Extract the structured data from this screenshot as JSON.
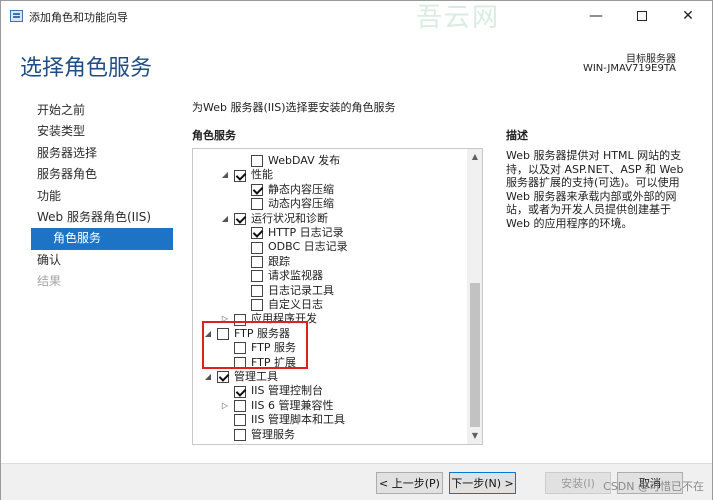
{
  "window": {
    "title": "添加角色和功能向导",
    "watermark_top": "吾云网",
    "controls": {
      "minimize": "—",
      "close": "✕"
    }
  },
  "header": {
    "page_title": "选择角色服务",
    "target_label": "目标服务器",
    "target_value": "WIN-JMAV719E9TA"
  },
  "nav": {
    "items": [
      {
        "label": "开始之前"
      },
      {
        "label": "安装类型"
      },
      {
        "label": "服务器选择"
      },
      {
        "label": "服务器角色"
      },
      {
        "label": "功能"
      },
      {
        "label": "Web 服务器角色(IIS)"
      },
      {
        "label": "角色服务"
      },
      {
        "label": "确认"
      },
      {
        "label": "结果"
      }
    ]
  },
  "main": {
    "description_line": "为Web 服务器(IIS)选择要安装的角色服务",
    "roles_heading": "角色服务",
    "description_heading": "描述",
    "description_text": "Web 服务器提供对 HTML 网站的支持，以及对 ASP.NET、ASP 和 Web 服务器扩展的支持(可选)。可以使用 Web 服务器来承载内部或外部的网站，或者为开发人员提供创建基于 Web 的应用程序的环境。"
  },
  "tree": {
    "items": [
      {
        "label": "WebDAV 发布",
        "state": "unchecked",
        "level": 2,
        "expander": "none"
      },
      {
        "label": "性能",
        "state": "checked",
        "level": 1,
        "expander": "expanded"
      },
      {
        "label": "静态内容压缩",
        "state": "checked",
        "level": 2,
        "expander": "none"
      },
      {
        "label": "动态内容压缩",
        "state": "unchecked",
        "level": 2,
        "expander": "none"
      },
      {
        "label": "运行状况和诊断",
        "state": "checked",
        "level": 1,
        "expander": "expanded"
      },
      {
        "label": "HTTP 日志记录",
        "state": "checked",
        "level": 2,
        "expander": "none"
      },
      {
        "label": "ODBC 日志记录",
        "state": "unchecked",
        "level": 2,
        "expander": "none"
      },
      {
        "label": "跟踪",
        "state": "unchecked",
        "level": 2,
        "expander": "none"
      },
      {
        "label": "请求监视器",
        "state": "unchecked",
        "level": 2,
        "expander": "none"
      },
      {
        "label": "日志记录工具",
        "state": "unchecked",
        "level": 2,
        "expander": "none"
      },
      {
        "label": "自定义日志",
        "state": "unchecked",
        "level": 2,
        "expander": "none"
      },
      {
        "label": "应用程序开发",
        "state": "unchecked",
        "level": 1,
        "expander": "collapsed"
      },
      {
        "label": "FTP 服务器",
        "state": "unchecked",
        "level": 0,
        "expander": "expanded"
      },
      {
        "label": "FTP 服务",
        "state": "unchecked",
        "level": 1,
        "expander": "none"
      },
      {
        "label": "FTP 扩展",
        "state": "unchecked",
        "level": 1,
        "expander": "none"
      },
      {
        "label": "管理工具",
        "state": "checked",
        "level": 0,
        "expander": "expanded"
      },
      {
        "label": "IIS 管理控制台",
        "state": "checked",
        "level": 1,
        "expander": "none"
      },
      {
        "label": "IIS 6 管理兼容性",
        "state": "unchecked",
        "level": 1,
        "expander": "collapsed"
      },
      {
        "label": "IIS 管理脚本和工具",
        "state": "unchecked",
        "level": 1,
        "expander": "none"
      },
      {
        "label": "管理服务",
        "state": "unchecked",
        "level": 1,
        "expander": "none"
      }
    ],
    "highlight_color": "#e0201e"
  },
  "footer": {
    "prev_label": "< 上一步(P)",
    "next_label": "下一步(N) >",
    "install_label": "安装(I)",
    "cancel_label": "取消",
    "watermark": "CSDN @可惜已不在"
  },
  "colors": {
    "title_blue": "#1f4e87",
    "nav_active": "#1d74c6"
  }
}
